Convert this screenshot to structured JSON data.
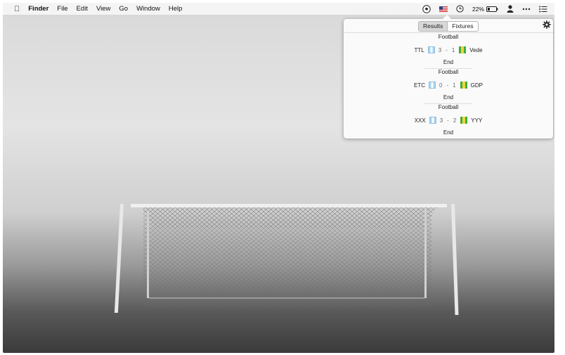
{
  "menubar": {
    "apple_icon": "apple-icon",
    "app_name": "Finder",
    "menus": [
      "File",
      "Edit",
      "View",
      "Go",
      "Window",
      "Help"
    ],
    "status": {
      "battery_percent": "22%",
      "icons": [
        "soccer-ball-icon",
        "us-flag-icon",
        "clock-icon",
        "battery-icon",
        "user-icon",
        "more-icon",
        "list-icon"
      ]
    }
  },
  "popover": {
    "tabs": [
      "Results",
      "Fixtures"
    ],
    "selected_tab": "Results",
    "settings_icon": "gear-icon",
    "matches": [
      {
        "sport": "Football",
        "home": "TTL",
        "home_score": "3",
        "away_score": "1",
        "away": "Vede",
        "status": "End"
      },
      {
        "sport": "Football",
        "home": "ETC",
        "home_score": "0",
        "away_score": "1",
        "away": "GDP",
        "status": "End"
      },
      {
        "sport": "Football",
        "home": "XXX",
        "home_score": "3",
        "away_score": "2",
        "away": "YYY",
        "status": "End"
      }
    ],
    "score_separator": "-",
    "flag_colors": {
      "home": "#a9d3f2",
      "away": "#3fae3f"
    }
  },
  "wallpaper": {
    "subject": "soccer goal in fog"
  }
}
